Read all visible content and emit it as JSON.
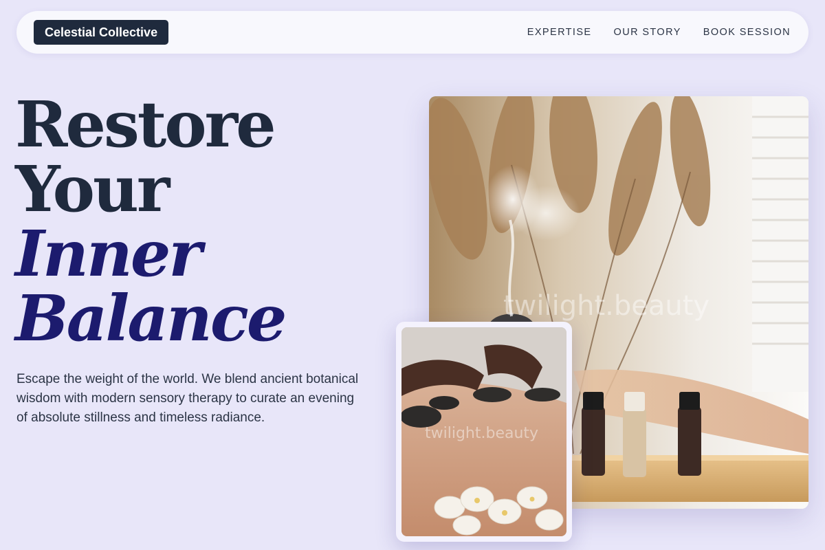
{
  "nav": {
    "brand": "Celestial Collective",
    "links": [
      {
        "label": "EXPERTISE"
      },
      {
        "label": "OUR STORY"
      },
      {
        "label": "BOOK SESSION"
      }
    ]
  },
  "hero": {
    "headline_lines": [
      "Restore",
      "Your",
      "Inner",
      "Balance"
    ],
    "intro": "Escape the weight of the world. We blend ancient botanical wisdom with modern sensory therapy to curate an evening of absolute stillness and timeless radiance."
  },
  "images": {
    "main_watermark": "twilight.beauty",
    "inset_watermark": "twilight.beauty"
  },
  "colors": {
    "background": "#e8e6f9",
    "brand_bg": "#1f2a3d",
    "heading": "#1f2a3d",
    "heading_italic": "#1c1b6e"
  }
}
